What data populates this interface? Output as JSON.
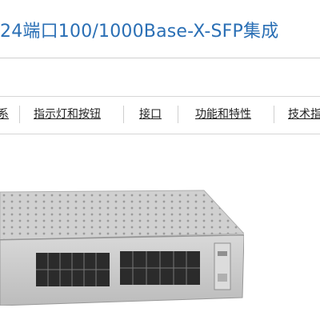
{
  "page": {
    "title": "24端口100/1000Base-X-SFP集成"
  },
  "tabs": [
    {
      "label": "系"
    },
    {
      "label": "指示灯和按钮"
    },
    {
      "label": "接口"
    },
    {
      "label": "功能和特性"
    },
    {
      "label": "技术指"
    }
  ],
  "colors": {
    "title": "#2a6fb5",
    "text": "#222222",
    "panel": "#c9c9c9",
    "port": "#2b2b2b"
  },
  "icons": {
    "product": "network-line-card-image"
  }
}
